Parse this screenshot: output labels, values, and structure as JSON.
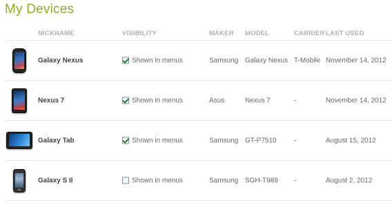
{
  "page": {
    "title": "My Devices"
  },
  "columns": {
    "nickname": "NICKNAME",
    "visibility": "VISIBILITY",
    "maker": "MAKER",
    "model": "MODEL",
    "carrier": "CARRIER",
    "last_used": "LAST USED"
  },
  "devices": [
    {
      "image": "galaxy-nexus-phone-icon",
      "nickname": "Galaxy Nexus",
      "visibility_label": "Shown in menus",
      "shown": true,
      "maker": "Samsung",
      "model": "Galaxy Nexus",
      "carrier": "T-Mobile",
      "last_used": "November 14, 2012"
    },
    {
      "image": "nexus-7-tablet-icon",
      "nickname": "Nexus 7",
      "visibility_label": "Shown in menus",
      "shown": true,
      "maker": "Asus",
      "model": "Nexus 7",
      "carrier": "-",
      "last_used": "November 14, 2012"
    },
    {
      "image": "galaxy-tab-tablet-icon",
      "nickname": "Galaxy Tab",
      "visibility_label": "Shown in menus",
      "shown": true,
      "maker": "Samsung",
      "model": "GT-P7510",
      "carrier": "-",
      "last_used": "August 15, 2012"
    },
    {
      "image": "galaxy-s2-phone-icon",
      "nickname": "Galaxy S II",
      "visibility_label": "Shown in menus",
      "shown": false,
      "maker": "Samsung",
      "model": "SGH-T989",
      "carrier": "-",
      "last_used": "August 2, 2012"
    }
  ],
  "colors": {
    "title": "#8dad28",
    "header_text": "#b0b0b0",
    "divider": "#e2e2e2",
    "check": "#2e7d32"
  }
}
